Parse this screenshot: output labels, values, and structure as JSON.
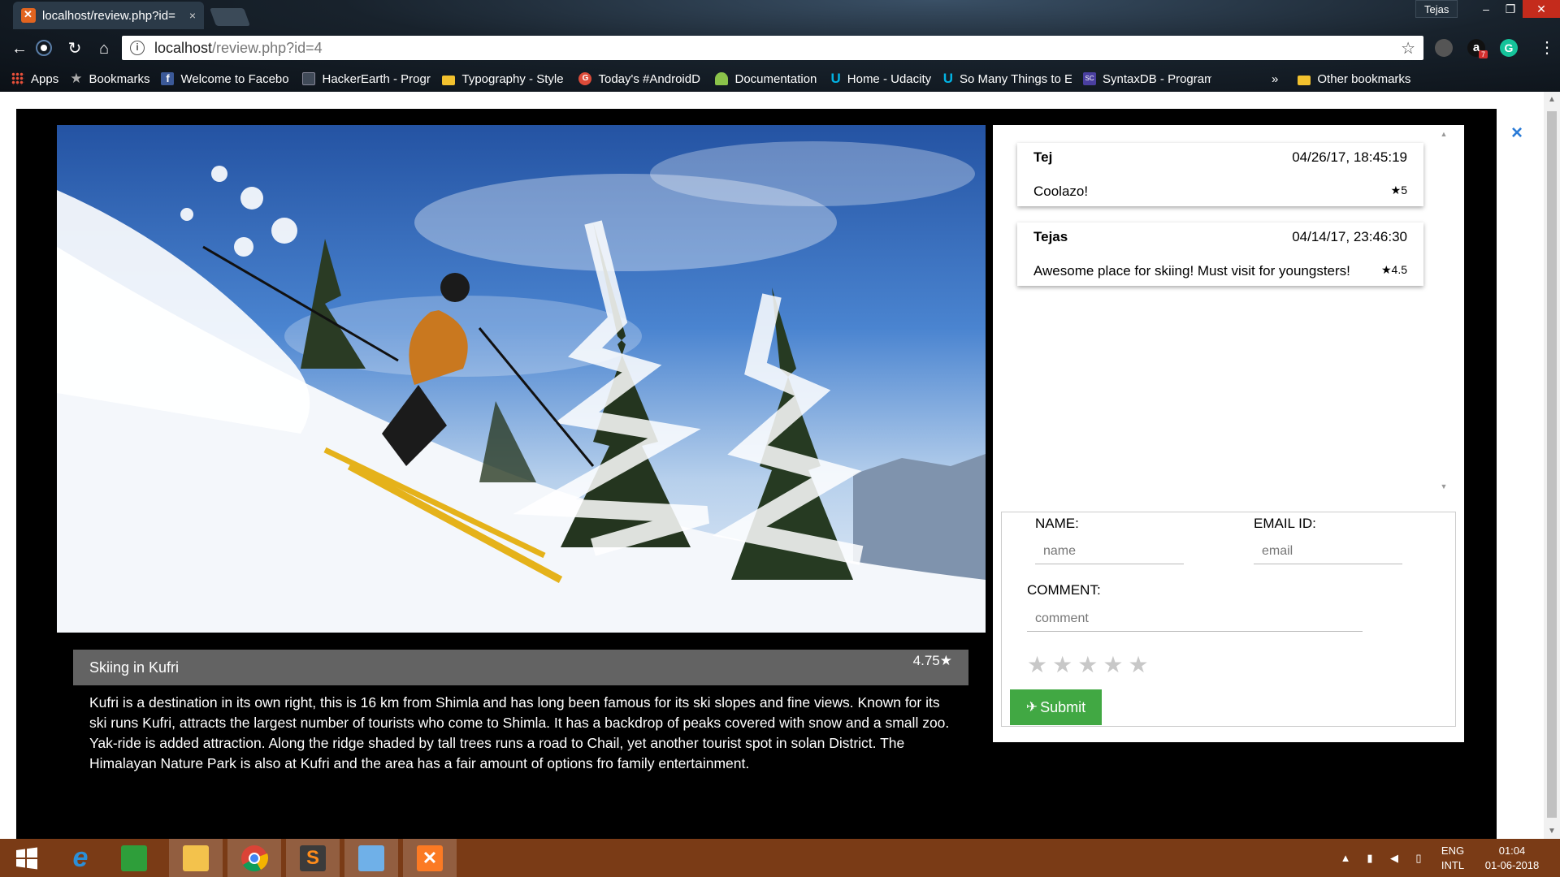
{
  "browser": {
    "tab_title": "localhost/review.php?id=",
    "tab_close": "×",
    "profile_name": "Tejas",
    "window_controls": [
      "–",
      "❐",
      "✕"
    ],
    "url_host": "localhost",
    "url_path": "/review.php?id=4",
    "extension_badge": "7",
    "bookmarks": [
      {
        "label": "Apps",
        "icon": "apps-grid-icon",
        "color": "#e8503a"
      },
      {
        "label": "Bookmarks",
        "icon": "star-icon",
        "color": "#aaaaaa"
      },
      {
        "label": "Welcome to Facebo",
        "icon": "facebook-icon",
        "color": "#3b5998"
      },
      {
        "label": "HackerEarth - Progra",
        "icon": "hackerearth-icon",
        "color": "#404a58"
      },
      {
        "label": "Typography - Style",
        "icon": "folder-icon",
        "color": "#f2c12e"
      },
      {
        "label": "Today's #AndroidD",
        "icon": "google-plus-icon",
        "color": "#dd4b39"
      },
      {
        "label": "Documentation",
        "icon": "android-icon",
        "color": "#8bc34a"
      },
      {
        "label": "Home - Udacity",
        "icon": "udacity-icon",
        "color": "#02b3e4"
      },
      {
        "label": "So Many Things to E",
        "icon": "udacity-icon",
        "color": "#02b3e4"
      },
      {
        "label": "SyntaxDB - Program",
        "icon": "syntaxdb-icon",
        "color": "#4a3fa0"
      }
    ],
    "bookmarks_overflow": "»",
    "other_bookmarks": "Other bookmarks"
  },
  "place": {
    "name": "Skiing in Kufri",
    "rating": "4.75★",
    "description": "Kufri is a destination in its own right, this is 16 km from Shimla and has long been famous for its ski slopes and fine views. Known for its ski runs Kufri, attracts the largest number of tourists who come to Shimla. It has a backdrop of peaks covered with snow and a small zoo. Yak-ride is added attraction. Along the ridge shaded by tall trees runs a road to Chail, yet another tourist spot in solan District. The Himalayan Nature Park is also at Kufri and the area has a fair amount of options fro family entertainment."
  },
  "reviews": [
    {
      "name": "Tej",
      "datetime": "04/26/17, 18:45:19",
      "comment": "Coolazo!",
      "rating": "★5"
    },
    {
      "name": "Tejas",
      "datetime": "04/14/17, 23:46:30",
      "comment": "Awesome place for skiing! Must visit for youngsters!",
      "rating": "★4.5"
    }
  ],
  "form": {
    "name_label": "NAME:",
    "name_placeholder": "name",
    "email_label": "EMAIL ID:",
    "email_placeholder": "email",
    "comment_label": "COMMENT:",
    "comment_placeholder": "comment",
    "star_count": 5,
    "submit_label": "Submit"
  },
  "modal": {
    "close": "×"
  },
  "taskbar": {
    "apps": [
      {
        "name": "start-icon",
        "color": "#ffffff"
      },
      {
        "name": "internet-explorer-icon",
        "color": "#2b8fd8"
      },
      {
        "name": "store-icon",
        "color": "#2e9e3a"
      },
      {
        "name": "file-explorer-icon",
        "color": "#f3c24c"
      },
      {
        "name": "chrome-icon",
        "color": "#db4437"
      },
      {
        "name": "sublime-text-icon",
        "color": "#ff8c1a"
      },
      {
        "name": "control-panel-icon",
        "color": "#6fb0e8"
      },
      {
        "name": "xampp-icon",
        "color": "#fb7a24"
      }
    ],
    "tray_language": "ENG",
    "tray_layout": "INTL",
    "time": "01:04",
    "date": "01-06-2018"
  }
}
